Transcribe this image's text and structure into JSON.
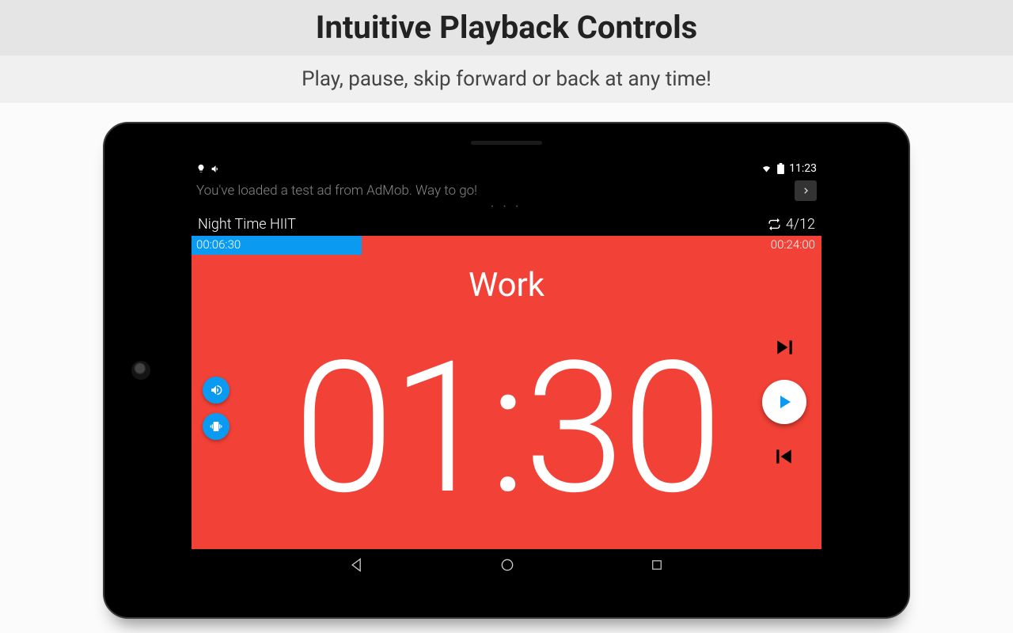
{
  "marketing": {
    "headline": "Intuitive Playback Controls",
    "subhead": "Play, pause, skip forward or back at any time!"
  },
  "statusbar": {
    "clock": "11:23"
  },
  "ad": {
    "text": "You've loaded a test ad from AdMob. Way to go!"
  },
  "workout": {
    "title": "Night Time HIIT",
    "rounds": "4/12",
    "elapsed": "00:06:30",
    "total": "00:24:00",
    "progress_pct": 27,
    "phase_label": "Work",
    "countdown": "01:30"
  },
  "colors": {
    "accent_red": "#f24136",
    "accent_blue": "#0a9af2"
  }
}
